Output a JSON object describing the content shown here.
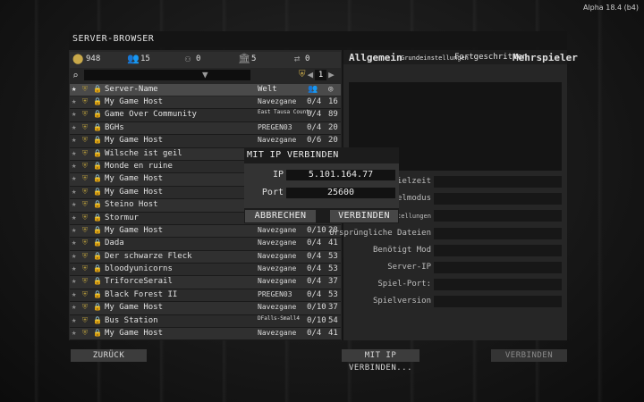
{
  "version": "Alpha 18.4 (b4)",
  "title": "SERVER-BROWSER",
  "stats": {
    "coins": "948",
    "players": "15",
    "groups": "0",
    "servers": "5",
    "sync": "0"
  },
  "filter": {
    "page": "1"
  },
  "columns": {
    "name": "Server-Name",
    "world": "Welt"
  },
  "servers": [
    {
      "name": "My Game Host",
      "world": "Navezgane",
      "players": "0/4",
      "ping": "16"
    },
    {
      "name": "Game Over Community",
      "world": "East Tausa County",
      "players": "0/4",
      "ping": "89"
    },
    {
      "name": "BGHs",
      "world": "PREGEN03",
      "players": "0/4",
      "ping": "20"
    },
    {
      "name": "My Game Host",
      "world": "Navezgane",
      "players": "0/6",
      "ping": "20"
    },
    {
      "name": "Wilsche ist geil",
      "world": "",
      "players": "",
      "ping": ""
    },
    {
      "name": "Monde en ruine",
      "world": "",
      "players": "",
      "ping": ""
    },
    {
      "name": "My Game Host",
      "world": "",
      "players": "",
      "ping": ""
    },
    {
      "name": "My Game Host",
      "world": "",
      "players": "",
      "ping": ""
    },
    {
      "name": "Steino Host",
      "world": "",
      "players": "",
      "ping": ""
    },
    {
      "name": "Stormur",
      "world": "",
      "players": "'6",
      "ping": ""
    },
    {
      "name": "My Game Host",
      "world": "Navezgane",
      "players": "0/10",
      "ping": "28"
    },
    {
      "name": "Dada",
      "world": "Navezgane",
      "players": "0/4",
      "ping": "41"
    },
    {
      "name": "Der schwarze Fleck",
      "world": "Navezgane",
      "players": "0/4",
      "ping": "53"
    },
    {
      "name": "bloodyunicorns",
      "world": "Navezgane",
      "players": "0/4",
      "ping": "53"
    },
    {
      "name": "TriforceSerail",
      "world": "Navezgane",
      "players": "0/4",
      "ping": "37"
    },
    {
      "name": "Black Forest II",
      "world": "PREGEN03",
      "players": "0/4",
      "ping": "53"
    },
    {
      "name": "My Game Host",
      "world": "Navezgane",
      "players": "0/10",
      "ping": "37"
    },
    {
      "name": "Bus Station",
      "world": "DFalls-Small4",
      "players": "0/10",
      "ping": "54"
    },
    {
      "name": "My Game Host",
      "world": "Navezgane",
      "players": "0/4",
      "ping": "41"
    }
  ],
  "tabs": {
    "general": "Allgemein",
    "basic": "Grundeinstellungen",
    "advanced": "Fortgeschritten",
    "multiplayer": "Mehrspieler"
  },
  "info_labels": {
    "playtime": "Spielzeit",
    "gamemode": "ielmodus",
    "settings": "stellungen",
    "original_files": "Ursprüngliche Dateien",
    "required_mod": "Benötigt Mod",
    "server_ip": "Server-IP",
    "game_port": "Spiel-Port:",
    "game_version": "Spielversion"
  },
  "buttons": {
    "back": "ZURÜCK",
    "connect_ip": "MIT IP VERBINDEN...",
    "connect": "VERBINDEN"
  },
  "modal": {
    "title": "MIT IP VERBINDEN",
    "ip_label": "IP",
    "ip_value": "5.101.164.77",
    "port_label": "Port",
    "port_value": "25600",
    "cancel": "ABBRECHEN",
    "connect": "VERBINDEN"
  },
  "colors": {
    "accent_gold": "#c9a94a"
  }
}
